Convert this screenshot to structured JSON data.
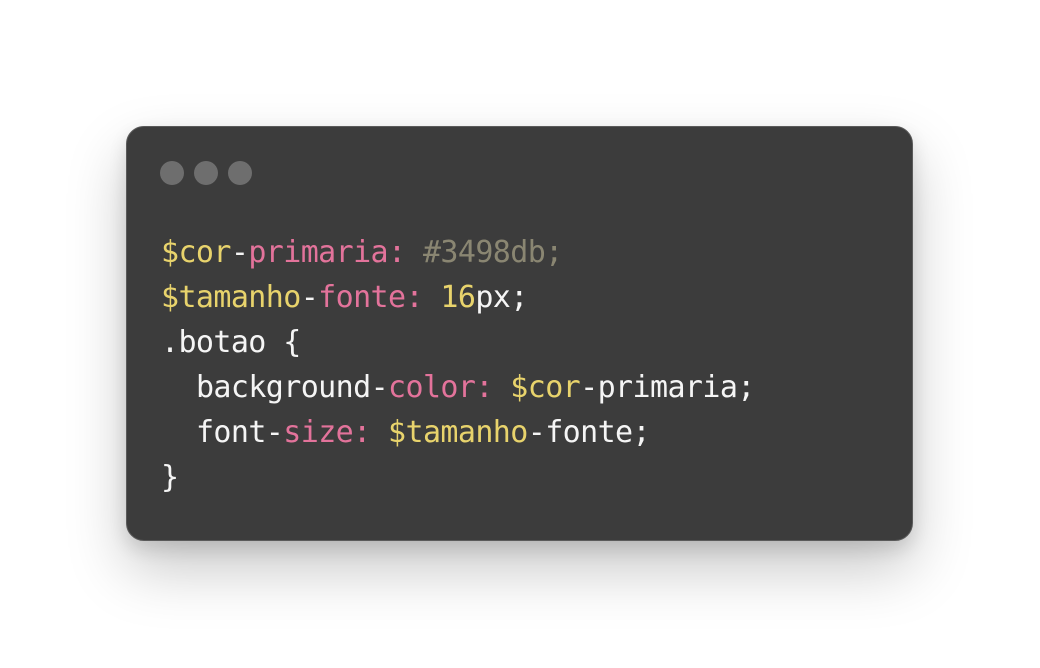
{
  "window": {
    "controls": [
      "window-dot-1",
      "window-dot-2",
      "window-dot-3"
    ]
  },
  "colors": {
    "variable": "#e8d36c",
    "property": "#e3739b",
    "comment_like": "#8a8672",
    "text": "#f5f5f5",
    "background": "#3c3c3c"
  },
  "code": {
    "line1": {
      "var": "$cor",
      "dash": "-",
      "prop": "primaria:",
      "value": " #3498db;"
    },
    "line2": {
      "var": "$tamanho",
      "dash": "-",
      "prop": "fonte:",
      "num": " 16",
      "unit": "px;"
    },
    "line3": {
      "selector": ".botao {"
    },
    "line4": {
      "indent": "  ",
      "prop1": "background",
      "dash1": "-",
      "prop2": "color:",
      "var": " $cor",
      "dash2": "-",
      "rest": "primaria;"
    },
    "line5": {
      "indent": "  ",
      "prop1": "font",
      "dash1": "-",
      "prop2": "size:",
      "var": " $tamanho",
      "dash2": "-",
      "rest": "fonte;"
    },
    "line6": {
      "close": "}"
    }
  }
}
